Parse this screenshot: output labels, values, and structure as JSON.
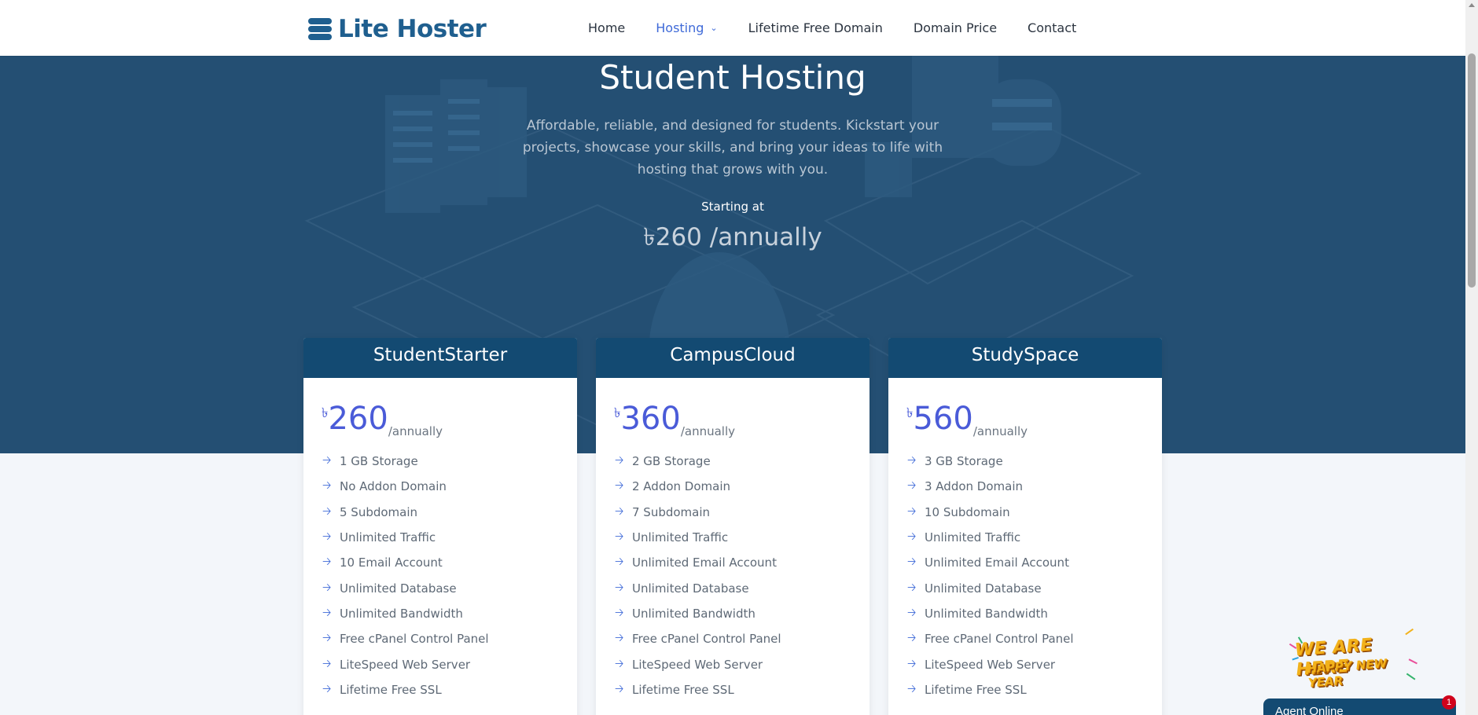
{
  "header": {
    "logo_text": "Lite Hoster",
    "nav": [
      {
        "label": "Home"
      },
      {
        "label": "Hosting",
        "active": true
      },
      {
        "label": "Lifetime Free Domain"
      },
      {
        "label": "Domain Price"
      },
      {
        "label": "Contact"
      }
    ]
  },
  "hero": {
    "title": "Student Hosting",
    "description": "Affordable, reliable, and designed for students. Kickstart your projects, showcase your skills, and bring your ideas to life with hosting that grows with you.",
    "starting_label": "Starting at",
    "starting_price": "৳260 /annually"
  },
  "plans": [
    {
      "name": "StudentStarter",
      "currency": "৳",
      "price": "260",
      "period": "/annually",
      "features": [
        "1 GB Storage",
        "No Addon Domain",
        "5 Subdomain",
        "Unlimited Traffic",
        "10 Email Account",
        "Unlimited Database",
        "Unlimited Bandwidth",
        "Free cPanel Control Panel",
        "LiteSpeed Web Server",
        "Lifetime Free SSL"
      ]
    },
    {
      "name": "CampusCloud",
      "currency": "৳",
      "price": "360",
      "period": "/annually",
      "features": [
        "2 GB Storage",
        "2 Addon Domain",
        "7 Subdomain",
        "Unlimited Traffic",
        "Unlimited Email Account",
        "Unlimited Database",
        "Unlimited Bandwidth",
        "Free cPanel Control Panel",
        "LiteSpeed Web Server",
        "Lifetime Free SSL"
      ]
    },
    {
      "name": "StudySpace",
      "currency": "৳",
      "price": "560",
      "period": "/annually",
      "features": [
        "3 GB Storage",
        "3 Addon Domain",
        "10 Subdomain",
        "Unlimited Traffic",
        "Unlimited Email Account",
        "Unlimited Database",
        "Unlimited Bandwidth",
        "Free cPanel Control Panel",
        "LiteSpeed Web Server",
        "Lifetime Free SSL"
      ]
    }
  ],
  "promo": {
    "line1": "WE ARE HERE",
    "line2": "HAPPY NEW YEAR"
  },
  "chat": {
    "label": "Agent Online",
    "badge": "1"
  },
  "icons": {
    "feature_bullet": "arrow-right-icon",
    "logo": "server-stack-icon"
  },
  "colors": {
    "brand": "#1f5f8f",
    "accent": "#3f6ad8",
    "hero_bg": "#244f73",
    "card_head": "#134a72"
  }
}
